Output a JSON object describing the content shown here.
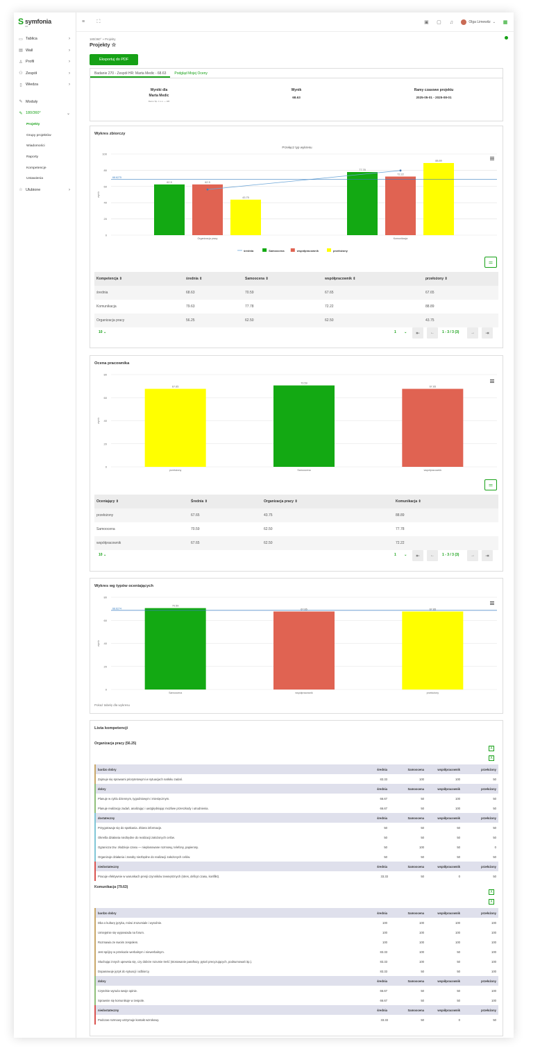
{
  "app": {
    "logo": "symfonia",
    "logo_sub": "HR"
  },
  "sidebar": {
    "items": [
      {
        "label": "Tablica",
        "icon": "desktop-icon",
        "chev": "›"
      },
      {
        "label": "Wall",
        "icon": "wall-icon",
        "chev": "›"
      },
      {
        "label": "Profil",
        "icon": "user-icon",
        "chev": "›"
      },
      {
        "label": "Zespół",
        "icon": "team-icon",
        "chev": "›"
      },
      {
        "label": "Wiedza",
        "icon": "book-icon",
        "chev": "›"
      }
    ],
    "modules": "Moduły",
    "active": {
      "label": "180/360°",
      "chev": "⌄"
    },
    "subitems": [
      "Projekty",
      "Grupy projektów",
      "Wiadomości",
      "Raporty",
      "Kompetencje",
      "Ustawienia"
    ],
    "favorites": {
      "label": "Ulubione",
      "chev": "›"
    }
  },
  "topbar": {
    "user": "Olga Limewitz"
  },
  "breadcrumb": "180/360° » Projekty",
  "page_title": "Projekty ☆",
  "pdf_button": "Eksportuj do PDF",
  "tabs": [
    "Badanie 270 - Zespół HR: Marta Medic - 68.63",
    "Podgląd Mojej Oceny"
  ],
  "summary": {
    "results_for_label": "Wyniki dla",
    "person": "Marta Medic",
    "company": "Demo Sp. z o.o. — HR",
    "score_label": "Wynik",
    "score": "68.63",
    "timeframe_label": "Ramy czasowe projektu",
    "timeframe": "2025-05-01 - 2025-08-01"
  },
  "chart1": {
    "title": "Wykres zbiorczy",
    "subtitle": "Przełącz typ wykresu",
    "ylabel": "wynik",
    "avg_label": "68.6275",
    "menu_icon": "hamburger-icon"
  },
  "chart_data": [
    {
      "type": "bar",
      "title": "Wykres zbiorczy",
      "subtitle": "Przełącz typ wykresu",
      "ylabel": "wynik",
      "ylim": [
        0,
        100
      ],
      "yticks": [
        0,
        20,
        40,
        60,
        80,
        100
      ],
      "categories": [
        "Organizacja pracy",
        "Komunikacja"
      ],
      "series": [
        {
          "name": "średnia",
          "kind": "line",
          "color": "#6ea7d8",
          "values": [
            56.25,
            79.63
          ]
        },
        {
          "name": "Samoocena",
          "color": "#13a913",
          "values": [
            62.5,
            77.78
          ]
        },
        {
          "name": "współpracownik",
          "color": "#e06352",
          "values": [
            62.5,
            72.22
          ]
        },
        {
          "name": "przełożony",
          "color": "#ffff00",
          "values": [
            43.75,
            88.89
          ]
        }
      ],
      "reference_line": 68.6275,
      "grid": true,
      "legend": "bottom"
    },
    {
      "type": "bar",
      "title": "Ocena pracownika",
      "ylabel": "wynik",
      "ylim": [
        0,
        80
      ],
      "yticks": [
        0,
        20,
        40,
        60,
        80
      ],
      "categories": [
        "przełożony",
        "Samoocena",
        "współpracownik"
      ],
      "values": [
        67.65,
        70.59,
        67.65
      ],
      "colors": [
        "#ffff00",
        "#13a913",
        "#e06352"
      ],
      "grid": true
    },
    {
      "type": "bar",
      "title": "Wykres wg typów oceniających",
      "ylabel": "wynik",
      "ylim": [
        0,
        80
      ],
      "yticks": [
        0,
        20,
        40,
        60,
        80
      ],
      "categories": [
        "Samoocena",
        "współpracownik",
        "przełożony"
      ],
      "values": [
        70.59,
        67.65,
        67.65
      ],
      "colors": [
        "#13a913",
        "#e06352",
        "#ffff00"
      ],
      "reference_line": 68.6274,
      "grid": true
    }
  ],
  "table1": {
    "headers": [
      "Kompetencja",
      "średnia",
      "Samoocena",
      "współpracownik",
      "przełożony"
    ],
    "rows": [
      [
        "średnia",
        "68.63",
        "70.59",
        "67.65",
        "67.65"
      ],
      [
        "Komunikacja",
        "79.63",
        "77.78",
        "72.22",
        "88.89"
      ],
      [
        "Organizacja pracy",
        "56.25",
        "62.50",
        "62.50",
        "43.75"
      ]
    ],
    "page_size": "10",
    "page": "1",
    "range": "1 - 3 / 3 (3)"
  },
  "chart2": {
    "title": "Ocena pracownika",
    "ylabel": "wynik"
  },
  "table2": {
    "headers": [
      "Oceniający",
      "Średnia",
      "Organizacja pracy",
      "Komunikacja"
    ],
    "rows": [
      [
        "przełożony",
        "67.65",
        "43.75",
        "88.89"
      ],
      [
        "Samoocena",
        "70.59",
        "62.50",
        "77.78"
      ],
      [
        "współpracownik",
        "67.65",
        "62.50",
        "72.22"
      ]
    ],
    "page_size": "10",
    "page": "1",
    "range": "1 - 3 / 3 (3)"
  },
  "chart3": {
    "title": "Wykres wg typów oceniających",
    "ylabel": "wynik",
    "avg_label": "68.6274",
    "show_table": "Pokaż tabelę dla wykresu"
  },
  "competences": {
    "title": "Lista kompetencji",
    "sections": [
      {
        "title": "Organizacja pracy (56.25)",
        "groups": [
          {
            "name": "bardzo dobry",
            "color": "#c9a86a",
            "rows": [
              [
                "Zajmuje się sprawami priorytetowymi w sytuacjach natłoku zadań.",
                "83.33",
                "100",
                "100",
                "50"
              ]
            ]
          },
          {
            "name": "dobry",
            "color": "#8fbf7a",
            "rows": [
              [
                "Planuje w cyklu dziennym, tygodniowym i miesięcznym.",
                "66.67",
                "50",
                "100",
                "50"
              ],
              [
                "Planuje realizację zadań, analizując i uwzględniając możliwe przeszkody i utrudnienia.",
                "66.67",
                "50",
                "100",
                "50"
              ]
            ]
          },
          {
            "name": "dostateczny",
            "color": "#7fc6d6",
            "rows": [
              [
                "Przygotowuje się do spotkania. Zbiera informacje.",
                "50",
                "50",
                "50",
                "50"
              ],
              [
                "Określa działania niezbędne do realizacji założonych celów.",
                "50",
                "50",
                "50",
                "50"
              ],
              [
                "Ogranicza tzw. złodzieje czasu — nieplanowane rozmowy, telefony, papierosy.",
                "50",
                "100",
                "50",
                "0"
              ],
              [
                "Organizuje działania i zasoby niezbędne do realizacji założonych celów.",
                "50",
                "50",
                "50",
                "50"
              ]
            ]
          },
          {
            "name": "niedostateczny",
            "color": "#d9534f",
            "rows": [
              [
                "Pracuje efektywnie w warunkach presji czynników zewnętrznych (stres, deficyt czasu, konflikt).",
                "33.33",
                "50",
                "0",
                "50"
              ]
            ]
          }
        ]
      },
      {
        "title": "Komunikacja (79.63)",
        "groups": [
          {
            "name": "bardzo dobry",
            "color": "#c9a86a",
            "rows": [
              [
                "Dba o kulturę języka, mówi zrozumiale i wyraźnie.",
                "100",
                "100",
                "100",
                "100"
              ],
              [
                "Umiejętnie się wypowiada na forum.",
                "100",
                "100",
                "100",
                "100"
              ],
              [
                "Rozmawia ze swoim zespołem.",
                "100",
                "100",
                "100",
                "100"
              ],
              [
                "Jest spójny w przekazie werbalnym i niewerbalnym.",
                "83.33",
                "100",
                "50",
                "100"
              ],
              [
                "Słuchając innych upewnia się, czy dobrze rozumie treść (stosowanie parafrazy, pytań precyzujących, podsumowań itp.).",
                "83.33",
                "100",
                "50",
                "100"
              ],
              [
                "Dopasowuje język do sytuacji i odbiorcy.",
                "83.33",
                "50",
                "50",
                "100"
              ]
            ]
          },
          {
            "name": "dobry",
            "color": "#8fbf7a",
            "rows": [
              [
                "Czytelnie wyraża swoje opinie.",
                "66.67",
                "50",
                "50",
                "100"
              ],
              [
                "Sprawnie się komunikuje w zespole.",
                "66.67",
                "50",
                "50",
                "100"
              ]
            ]
          },
          {
            "name": "niedostateczny",
            "color": "#d9534f",
            "rows": [
              [
                "Podczas rozmowy utrzymuje kontakt wzrokowy.",
                "33.33",
                "50",
                "0",
                "50"
              ]
            ]
          }
        ]
      }
    ],
    "col_headers": [
      "średnia",
      "Samoocena",
      "współpracownik",
      "przełożony"
    ]
  }
}
